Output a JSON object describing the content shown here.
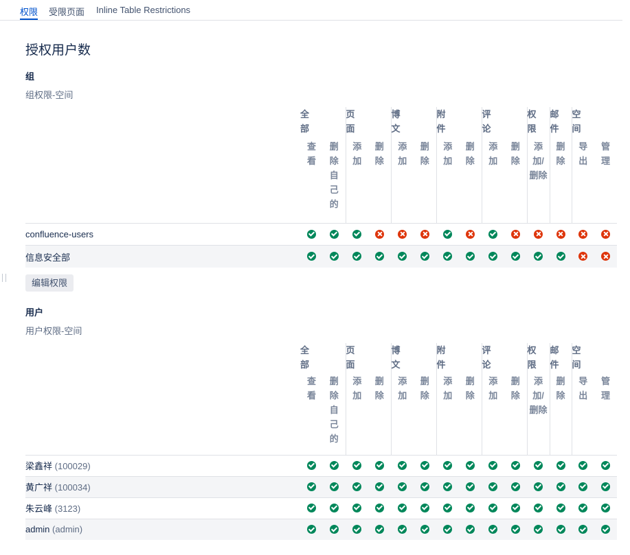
{
  "tabs": [
    {
      "label": "权限",
      "active": true
    },
    {
      "label": "受限页面",
      "active": false
    },
    {
      "label": "Inline Table Restrictions",
      "active": false
    }
  ],
  "page_title": "授权用户数",
  "colors": {
    "accent": "#0052cc",
    "allowed": "#00875a",
    "denied": "#de350b",
    "row_alt": "#f4f5f7"
  },
  "groups_section": {
    "title": "组",
    "subtitle": "组权限-空间",
    "header_groups": [
      "全部",
      "页面",
      "博文",
      "附件",
      "评论",
      "权限",
      "邮件",
      "空间"
    ],
    "header_ops": [
      "查看",
      "删除自己的",
      "添加",
      "删除",
      "添加",
      "删除",
      "添加",
      "删除",
      "添加",
      "删除",
      "添加/删除",
      "删除",
      "导出",
      "管理"
    ],
    "rows": [
      {
        "name": "confluence-users",
        "id": "",
        "perms": [
          true,
          true,
          true,
          false,
          false,
          false,
          true,
          false,
          true,
          false,
          false,
          false,
          false,
          false
        ]
      },
      {
        "name": "信息安全部",
        "id": "",
        "perms": [
          true,
          true,
          true,
          true,
          true,
          true,
          true,
          true,
          true,
          true,
          true,
          true,
          false,
          false
        ]
      }
    ],
    "edit_button": "编辑权限"
  },
  "users_section": {
    "title": "用户",
    "subtitle": "用户权限-空间",
    "header_groups": [
      "全部",
      "页面",
      "博文",
      "附件",
      "评论",
      "权限",
      "邮件",
      "空间"
    ],
    "header_ops": [
      "查看",
      "删除自己的",
      "添加",
      "删除",
      "添加",
      "删除",
      "添加",
      "删除",
      "添加",
      "删除",
      "添加/删除",
      "删除",
      "导出",
      "管理"
    ],
    "rows": [
      {
        "name": "梁鑫祥",
        "id": "(100029)",
        "perms": [
          true,
          true,
          true,
          true,
          true,
          true,
          true,
          true,
          true,
          true,
          true,
          true,
          true,
          true
        ]
      },
      {
        "name": "黄广祥",
        "id": "(100034)",
        "perms": [
          true,
          true,
          true,
          true,
          true,
          true,
          true,
          true,
          true,
          true,
          true,
          true,
          true,
          true
        ]
      },
      {
        "name": "朱云峰",
        "id": "(3123)",
        "perms": [
          true,
          true,
          true,
          true,
          true,
          true,
          true,
          true,
          true,
          true,
          true,
          true,
          true,
          true
        ]
      },
      {
        "name": "admin",
        "id": "(admin)",
        "perms": [
          true,
          true,
          true,
          true,
          true,
          true,
          true,
          true,
          true,
          true,
          true,
          true,
          true,
          true
        ]
      }
    ]
  }
}
